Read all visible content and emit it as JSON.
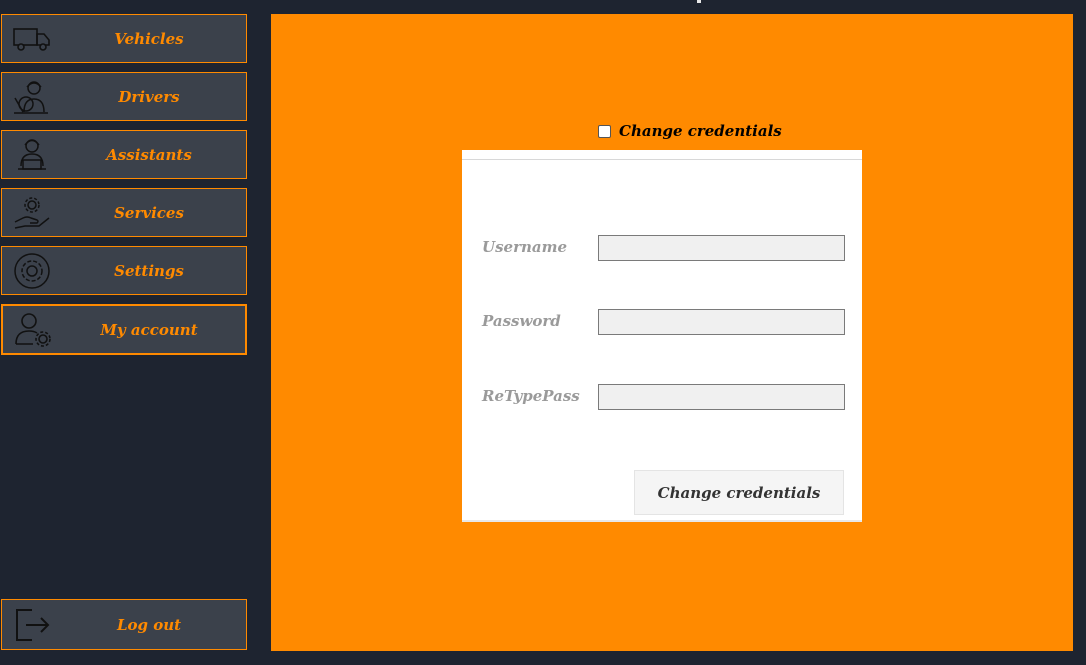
{
  "sidebar": {
    "items": [
      {
        "label": "Vehicles",
        "icon": "truck-icon"
      },
      {
        "label": "Drivers",
        "icon": "driver-icon"
      },
      {
        "label": "Assistants",
        "icon": "assistant-icon"
      },
      {
        "label": "Services",
        "icon": "services-icon"
      },
      {
        "label": "Settings",
        "icon": "settings-icon"
      },
      {
        "label": "My account",
        "icon": "user-settings-icon",
        "active": true
      }
    ],
    "logout": {
      "label": "Log out",
      "icon": "logout-icon"
    }
  },
  "form": {
    "checkbox_label": "Change credentials",
    "checkbox_checked": false,
    "username_label": "Username",
    "username_value": "",
    "password_label": "Password",
    "password_value": "",
    "retype_label": "ReTypePass",
    "retype_value": "",
    "submit_label": "Change credentials"
  },
  "colors": {
    "accent": "#ff8a00",
    "sidebar_bg": "#1e2430",
    "button_bg": "#3b414b",
    "panel_bg": "#ffffff"
  }
}
